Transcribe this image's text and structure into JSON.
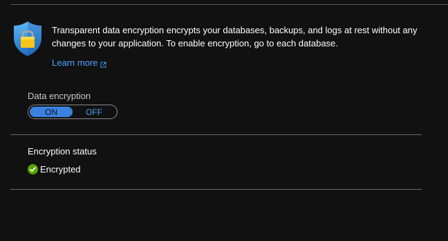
{
  "info": {
    "icon": "shield-lock-icon",
    "text": "Transparent data encryption encrypts your databases, backups, and logs at rest without any changes to your application. To enable encryption, go to each database.",
    "learn_more_label": "Learn more",
    "learn_more_icon": "external-link-icon"
  },
  "encryption": {
    "label": "Data encryption",
    "on_label": "ON",
    "off_label": "OFF",
    "selected": "ON"
  },
  "status": {
    "title": "Encryption status",
    "value": "Encrypted",
    "icon": "check-circle-icon"
  },
  "colors": {
    "background": "#111111",
    "link": "#4aa0ff",
    "toggle_on": "#3b82e0",
    "success": "#57a300"
  }
}
